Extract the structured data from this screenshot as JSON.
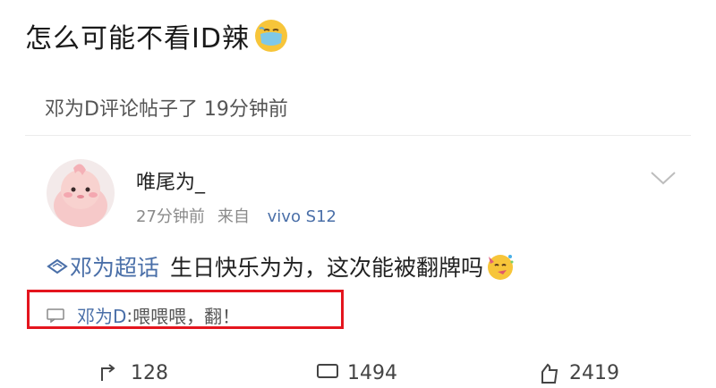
{
  "header": {
    "text": "怎么可能不看ID辣",
    "emoji_icon": "mask-face-emoji-icon"
  },
  "activity": {
    "text": "邓为D评论帖子了 19分钟前"
  },
  "post": {
    "username": "唯尾为_",
    "time": "27分钟前",
    "from_label": "来自",
    "device": "vivo S12",
    "topic": "邓为超话",
    "content": "生日快乐为为，这次能被翻牌吗",
    "emoji_icon": "party-face-emoji-icon"
  },
  "comment": {
    "author": "邓为D",
    "separator": ":",
    "text": " 喂喂喂，翻！"
  },
  "actions": {
    "repost": "128",
    "comments": "1494",
    "likes": "2419"
  },
  "colors": {
    "link": "#4a6fa8",
    "highlight_box": "#e4151e"
  }
}
